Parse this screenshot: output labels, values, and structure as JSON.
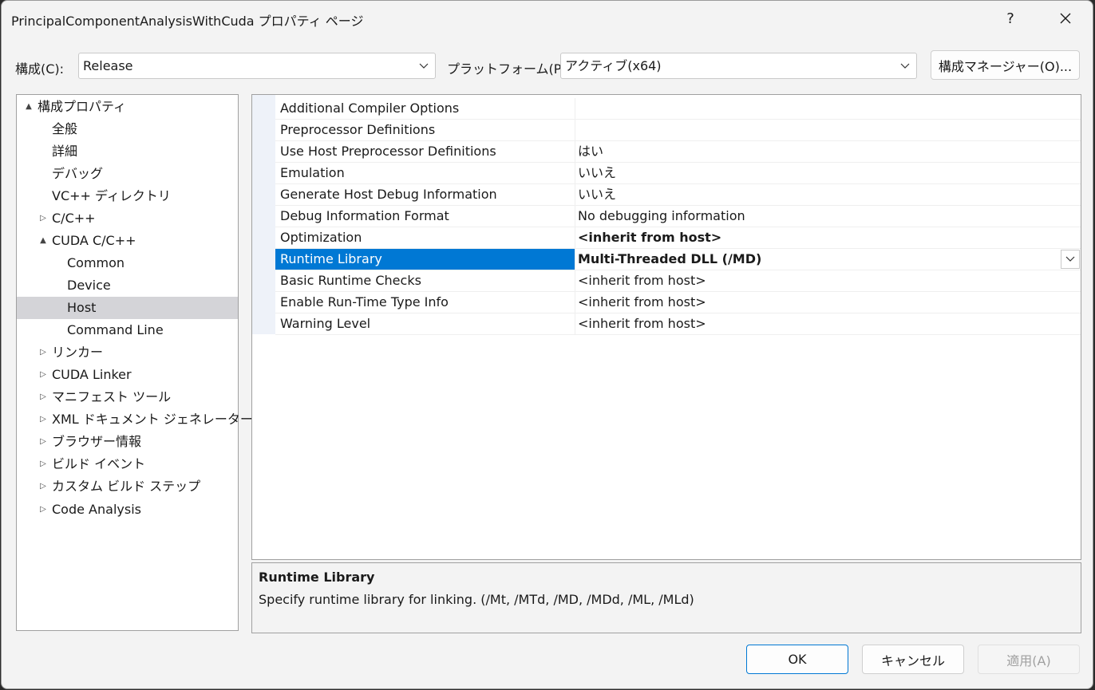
{
  "window": {
    "title": "PrincipalComponentAnalysisWithCuda プロパティ ページ",
    "help": "?",
    "close": "✕"
  },
  "config": {
    "config_label": "構成(C):",
    "config_value": "Release",
    "platform_label": "プラットフォーム(P):",
    "platform_value": "アクティブ(x64)",
    "manager_button": "構成マネージャー(O)..."
  },
  "tree": {
    "items": [
      {
        "label": "構成プロパティ",
        "expander": "▲"
      },
      {
        "label": "全般",
        "expander": ""
      },
      {
        "label": "詳細",
        "expander": ""
      },
      {
        "label": "デバッグ",
        "expander": ""
      },
      {
        "label": "VC++ ディレクトリ",
        "expander": ""
      },
      {
        "label": "C/C++",
        "expander": "▷"
      },
      {
        "label": "CUDA C/C++",
        "expander": "▲"
      },
      {
        "label": "Common",
        "expander": ""
      },
      {
        "label": "Device",
        "expander": ""
      },
      {
        "label": "Host",
        "expander": ""
      },
      {
        "label": "Command Line",
        "expander": ""
      },
      {
        "label": "リンカー",
        "expander": "▷"
      },
      {
        "label": "CUDA Linker",
        "expander": "▷"
      },
      {
        "label": "マニフェスト ツール",
        "expander": "▷"
      },
      {
        "label": "XML ドキュメント ジェネレーター",
        "expander": "▷"
      },
      {
        "label": "ブラウザー情報",
        "expander": "▷"
      },
      {
        "label": "ビルド イベント",
        "expander": "▷"
      },
      {
        "label": "カスタム ビルド ステップ",
        "expander": "▷"
      },
      {
        "label": "Code Analysis",
        "expander": "▷"
      }
    ]
  },
  "grid": {
    "rows": [
      {
        "name": "Additional Compiler Options",
        "value": ""
      },
      {
        "name": "Preprocessor Definitions",
        "value": ""
      },
      {
        "name": "Use Host Preprocessor Definitions",
        "value": "はい"
      },
      {
        "name": "Emulation",
        "value": "いいえ"
      },
      {
        "name": "Generate Host Debug Information",
        "value": "いいえ"
      },
      {
        "name": "Debug Information Format",
        "value": "No debugging information"
      },
      {
        "name": "Optimization",
        "value": "<inherit from host>"
      },
      {
        "name": "Runtime Library",
        "value": "Multi-Threaded DLL (/MD)"
      },
      {
        "name": "Basic Runtime Checks",
        "value": "<inherit from host>"
      },
      {
        "name": "Enable Run-Time Type Info",
        "value": "<inherit from host>"
      },
      {
        "name": "Warning Level",
        "value": "<inherit from host>"
      }
    ]
  },
  "description": {
    "title": "Runtime Library",
    "text": "Specify runtime library for linking. (/Mt, /MTd, /MD, /MDd, /ML, /MLd)"
  },
  "buttons": {
    "ok": "OK",
    "cancel": "キャンセル",
    "apply": "適用(A)"
  },
  "colors": {
    "accent": "#0078d4",
    "tree_selection": "#d4d4d8",
    "disabled_text": "#a0a0a0"
  }
}
